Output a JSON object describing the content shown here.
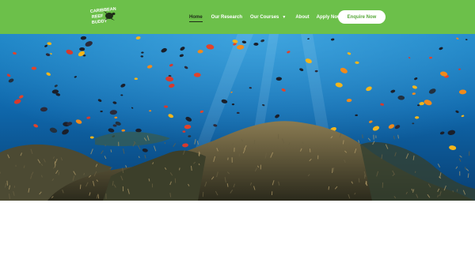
{
  "header": {
    "logo": {
      "lines": [
        "CARIBBEAN",
        "REEF",
        "BUDDY"
      ],
      "icon": "turtle-icon"
    },
    "nav": [
      {
        "label": "Home",
        "active": true
      },
      {
        "label": "Our Research",
        "active": false
      },
      {
        "label": "Our Courses",
        "active": false,
        "dropdown": true
      },
      {
        "label": "About",
        "active": false
      },
      {
        "label": "Apply Now",
        "active": false
      }
    ],
    "cta_label": "Enquire Now",
    "dropdown_icon": "chevron-down-icon"
  },
  "hero": {
    "image": "underwater-coral-reef-with-fish"
  },
  "colors": {
    "brand_green": "#6cc04a",
    "active_text": "#1e2a17",
    "cta_text": "#57a83a",
    "ocean_deep": "#0b4f8c",
    "ocean_light": "#1b86c9"
  }
}
